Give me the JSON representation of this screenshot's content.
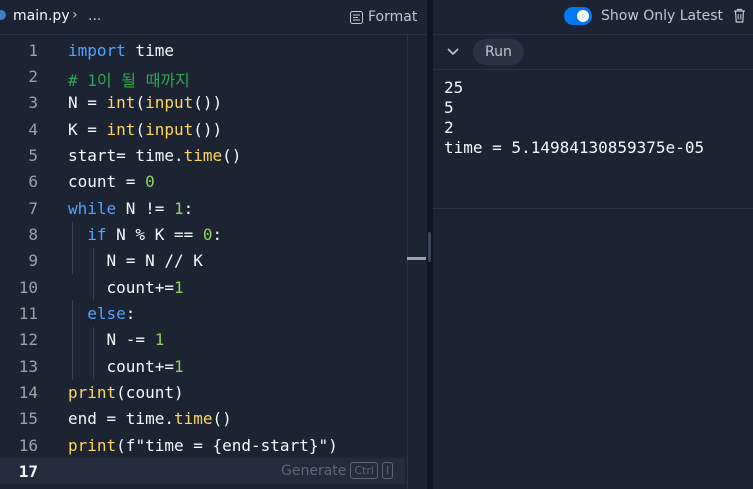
{
  "editor": {
    "breadcrumb": {
      "file": "main.py",
      "chevron": "›",
      "more": "..."
    },
    "format_label": "Format",
    "line_numbers": [
      "1",
      "2",
      "3",
      "4",
      "5",
      "6",
      "7",
      "8",
      "9",
      "10",
      "11",
      "12",
      "13",
      "14",
      "15",
      "16",
      "17"
    ],
    "code_lines": [
      "import time",
      "# 1이 될 때까지",
      "N = int(input())",
      "K = int(input())",
      "start= time.time()",
      "count = 0",
      "while N != 1:",
      "  if N % K == 0:",
      "    N = N // K",
      "    count+=1",
      "  else:",
      "    N -= 1",
      "    count+=1",
      "print(count)",
      "end = time.time()",
      "print(f\"time = {end-start}\")",
      ""
    ],
    "generate_hint": {
      "label": "Generate",
      "key1": "Ctrl",
      "key2": "I"
    }
  },
  "console": {
    "toggle": {
      "label": "Show Only Latest",
      "on": true
    },
    "run_label": "Run",
    "output_lines": [
      "25",
      "5",
      "2",
      "time = 5.14984130859375e-05"
    ]
  },
  "colors": {
    "background": "#1c2333",
    "keyword": "#4fa4ff",
    "function": "#ffd65c",
    "number": "#90d35a",
    "comment": "#2fa84f",
    "toggle_on": "#0079f2"
  },
  "icons": [
    "python-file-icon",
    "format-icon",
    "trash-icon",
    "chevron-down-icon"
  ]
}
